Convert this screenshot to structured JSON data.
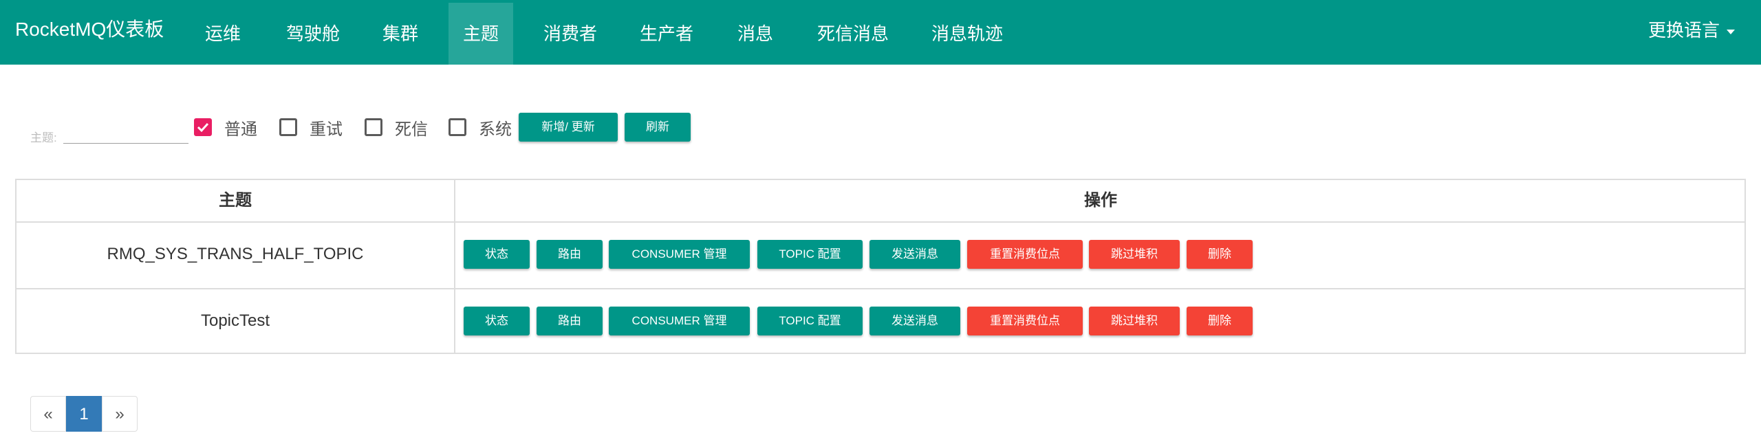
{
  "navbar": {
    "brand": "RocketMQ仪表板",
    "items": [
      "运维",
      "驾驶舱",
      "集群",
      "主题",
      "消费者",
      "生产者",
      "消息",
      "死信消息",
      "消息轨迹"
    ],
    "active_item": "主题",
    "language_label": "更换语言"
  },
  "filter": {
    "label": "主题:",
    "input_value": "",
    "checkboxes": [
      {
        "label": "普通",
        "checked": true
      },
      {
        "label": "重试",
        "checked": false
      },
      {
        "label": "死信",
        "checked": false
      },
      {
        "label": "系统",
        "checked": false
      }
    ],
    "add_update_label": "新增/ 更新",
    "refresh_label": "刷新"
  },
  "table": {
    "headers": [
      "主题",
      "操作"
    ],
    "rows": [
      {
        "topic": "RMQ_SYS_TRANS_HALF_TOPIC"
      },
      {
        "topic": "TopicTest"
      }
    ],
    "actions": [
      "状态",
      "路由",
      "CONSUMER 管理",
      "TOPIC 配置",
      "发送消息",
      "重置消费位点",
      "跳过堆积",
      "删除"
    ]
  },
  "pagination": {
    "prev": "«",
    "current": "1",
    "next": "»"
  },
  "colors": {
    "primary": "#009688",
    "danger": "#f44336",
    "checkbox_checked": "#e91e63",
    "page_active": "#337ab7"
  }
}
